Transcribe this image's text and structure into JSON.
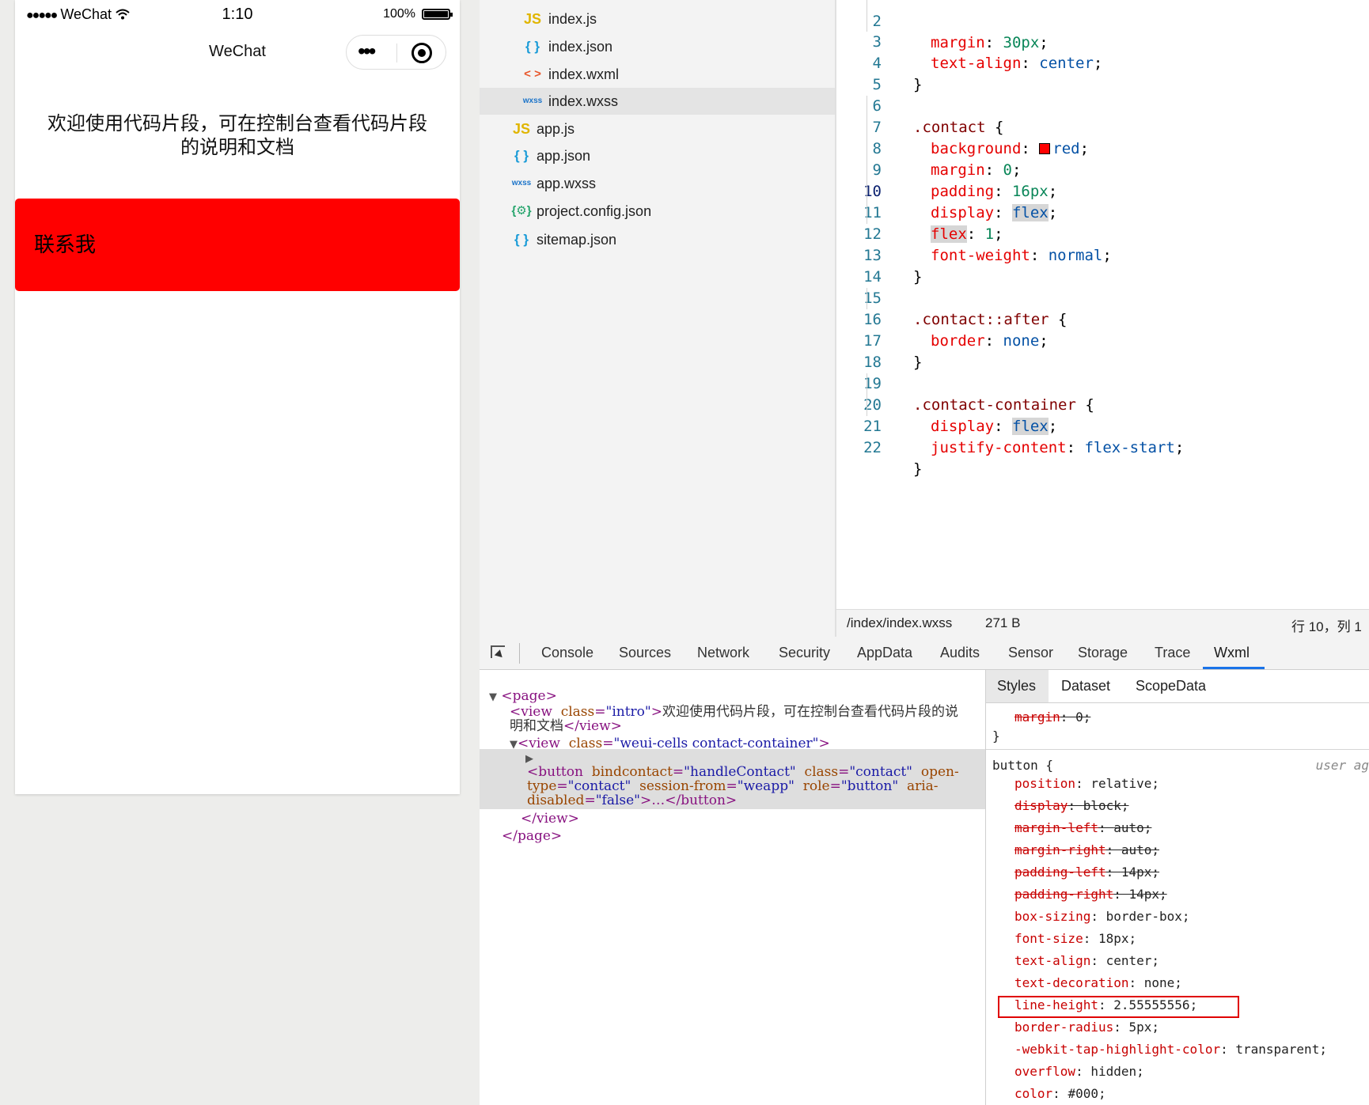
{
  "phone": {
    "status": {
      "carrier_dots": "●●●●●",
      "carrier": "WeChat",
      "wifi_icon": "wifi-icon",
      "time": "1:10",
      "battery": "100%"
    },
    "nav": {
      "title": "WeChat",
      "more_icon": "•••",
      "close_icon": "target-icon"
    },
    "intro": "欢迎使用代码片段，可在控制台查看代码片段的说明和文档",
    "contact_button": "联系我",
    "contact_color": "#ff0000"
  },
  "filetree": {
    "files": [
      {
        "icon": "JS",
        "name": "index.js"
      },
      {
        "icon": "{ }",
        "name": "index.json"
      },
      {
        "icon": "< >",
        "name": "index.wxml"
      },
      {
        "icon": "wxss",
        "name": "index.wxss"
      },
      {
        "icon": "JS",
        "name": "app.js"
      },
      {
        "icon": "{ }",
        "name": "app.json"
      },
      {
        "icon": "wxss",
        "name": "app.wxss"
      },
      {
        "icon": "{⚙}",
        "name": "project.config.json"
      },
      {
        "icon": "{ }",
        "name": "sitemap.json"
      }
    ]
  },
  "editor": {
    "lines": [
      {
        "n": "2",
        "t": "margin: 30px;"
      },
      {
        "n": "3",
        "t": "text-align: center;"
      },
      {
        "n": "4",
        "t": "}"
      },
      {
        "n": "5",
        "t": ""
      },
      {
        "n": "6",
        "t": ".contact {"
      },
      {
        "n": "7",
        "t": "background: red;"
      },
      {
        "n": "8",
        "t": "margin: 0;"
      },
      {
        "n": "9",
        "t": "padding: 16px;"
      },
      {
        "n": "10",
        "t": "display: flex;"
      },
      {
        "n": "11",
        "t": "flex: 1;"
      },
      {
        "n": "12",
        "t": "font-weight: normal;"
      },
      {
        "n": "13",
        "t": "}"
      },
      {
        "n": "14",
        "t": ""
      },
      {
        "n": "15",
        "t": ".contact::after {"
      },
      {
        "n": "16",
        "t": "border: none;"
      },
      {
        "n": "17",
        "t": "}"
      },
      {
        "n": "18",
        "t": ""
      },
      {
        "n": "19",
        "t": ".contact-container {"
      },
      {
        "n": "20",
        "t": "display: flex;"
      },
      {
        "n": "21",
        "t": "justify-content: flex-start;"
      },
      {
        "n": "22",
        "t": "}"
      }
    ],
    "status": {
      "path": "/index/index.wxss",
      "size": "271 B",
      "position": "行 10，列 1"
    }
  },
  "devtools": {
    "tabs": [
      "Console",
      "Sources",
      "Network",
      "Security",
      "AppData",
      "Audits",
      "Sensor",
      "Storage",
      "Trace",
      "Wxml"
    ],
    "active_tab": "Wxml",
    "wxml": {
      "page_open": "<page>",
      "intro_attr": "class",
      "intro_val": "\"intro\"",
      "intro_text1": "欢迎使用代码片段，可在控制台查看代码片段的说",
      "intro_text2": "明和文档",
      "view_close": "</view>",
      "container_val": "\"weui-cells contact-container\"",
      "btn_line1_a": "bindcontact",
      "btn_line1_av": "\"handleContact\"",
      "btn_line1_b": "class",
      "btn_line1_bv": "\"contact\"",
      "btn_line1_c": "open-",
      "btn_line2_a": "type",
      "btn_line2_av": "\"contact\"",
      "btn_line2_b": "session-from",
      "btn_line2_bv": "\"weapp\"",
      "btn_line2_c": "role",
      "btn_line2_cv": "\"button\"",
      "btn_line2_d": "aria-",
      "btn_line3_a": "disabled",
      "btn_line3_av": "\"false\"",
      "btn_line3_rest": "…</button>",
      "page_close": "</page>"
    },
    "styles": {
      "subtabs": [
        "Styles",
        "Dataset",
        "ScopeData"
      ],
      "top_rule": {
        "prop": "margin",
        "val": "0;"
      },
      "button_selector": "button {",
      "source": "user ag",
      "props": [
        {
          "p": "position",
          "v": "relative;",
          "struck": false
        },
        {
          "p": "display",
          "v": "block;",
          "struck": true
        },
        {
          "p": "margin-left",
          "v": "auto;",
          "struck": true
        },
        {
          "p": "margin-right",
          "v": "auto;",
          "struck": true
        },
        {
          "p": "padding-left",
          "v": "14px;",
          "struck": true
        },
        {
          "p": "padding-right",
          "v": "14px;",
          "struck": true
        },
        {
          "p": "box-sizing",
          "v": "border-box;",
          "struck": false
        },
        {
          "p": "font-size",
          "v": "18px;",
          "struck": false
        },
        {
          "p": "text-align",
          "v": "center;",
          "struck": false
        },
        {
          "p": "text-decoration",
          "v": "none;",
          "struck": false
        },
        {
          "p": "line-height",
          "v": "2.55555556;",
          "struck": false
        },
        {
          "p": "border-radius",
          "v": "5px;",
          "struck": false
        },
        {
          "p": "-webkit-tap-highlight-color",
          "v": "transparent;",
          "struck": false
        },
        {
          "p": "overflow",
          "v": "hidden;",
          "struck": false
        },
        {
          "p": "color",
          "v": "#000;",
          "struck": false
        }
      ]
    }
  }
}
